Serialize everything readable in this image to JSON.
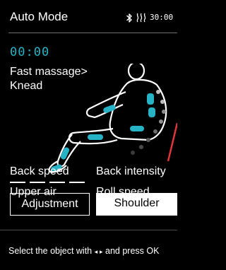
{
  "header": {
    "title": "Auto Mode",
    "time": "30:00",
    "bluetooth_icon": "bluetooth-icon",
    "heat_icon": "heat-icon"
  },
  "session": {
    "timer": "00:00",
    "mode_line1": "Fast massage>",
    "mode_line2": "Knead"
  },
  "colors": {
    "accent": "#27b3c6",
    "indicator": "#e0353a",
    "background": "#000000"
  },
  "settings": {
    "back_speed": "Back speed",
    "back_intensity": "Back intensity",
    "upper_air": "Upper air",
    "roll_speed": "Roll speed"
  },
  "buttons": {
    "adjustment": "Adjustment",
    "shoulder": "Shoulder"
  },
  "hint": {
    "before": "Select the object with",
    "arrows": "◂ ▸",
    "after": "and press OK"
  }
}
